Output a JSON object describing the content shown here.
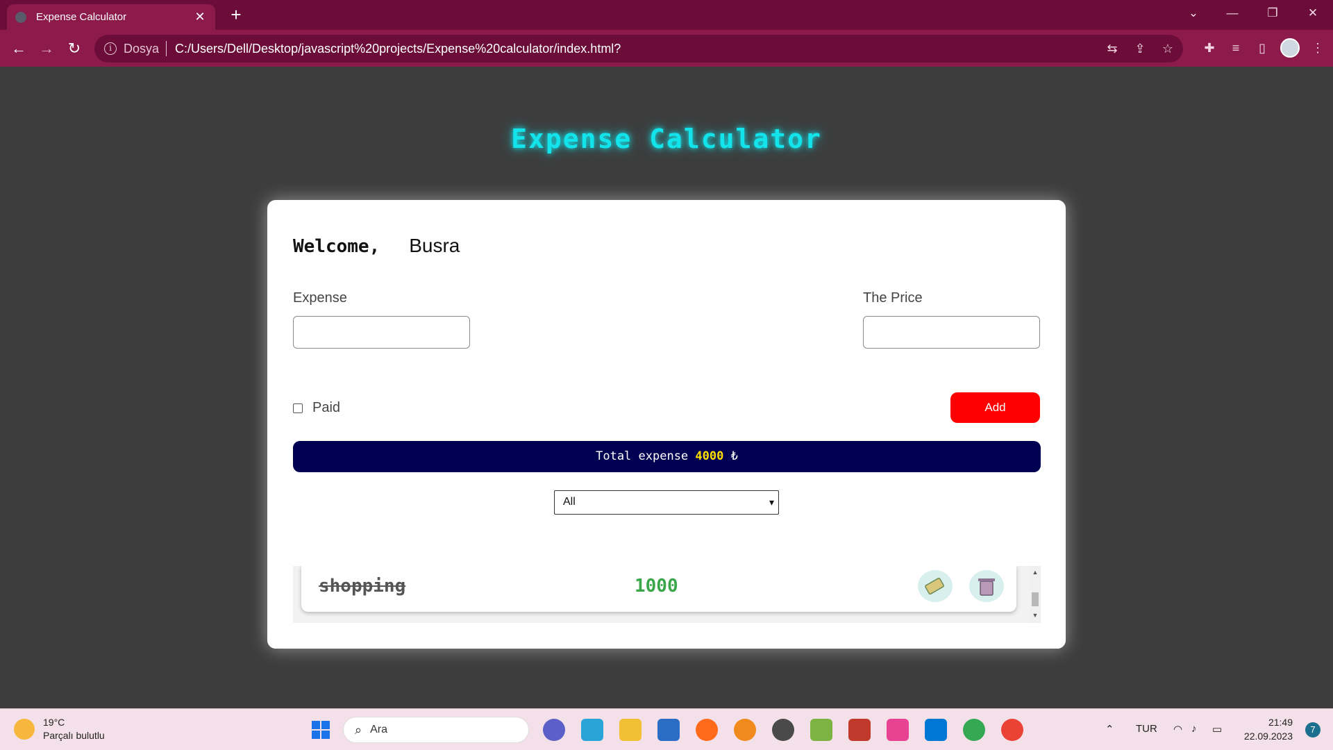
{
  "browser": {
    "tab_title": "Expense Calculator",
    "tab_close": "✕",
    "new_tab": "+",
    "scheme_label": "Dosya",
    "url": "C:/Users/Dell/Desktop/javascript%20projects/Expense%20calculator/index.html?",
    "window_controls": [
      "⌄",
      "—",
      "❐",
      "✕"
    ]
  },
  "app": {
    "title": "Expense Calculator",
    "welcome_label": "Welcome,",
    "user_name": "Busra",
    "expense_label": "Expense",
    "price_label": "The Price",
    "paid_label": "Paid",
    "add_label": "Add",
    "total_prefix": "Total expense",
    "total_amount": "4000",
    "currency": "₺",
    "filter_selected": "All",
    "items": [
      {
        "name": "shopping",
        "price": "1000",
        "paid": true
      }
    ]
  },
  "taskbar": {
    "temperature": "19°C",
    "weather": "Parçalı bulutlu",
    "search_placeholder": "Ara",
    "language": "TUR",
    "time": "21:49",
    "date": "22.09.2023",
    "notifications": "7"
  },
  "colors": {
    "title_glow": "#13e4ec",
    "add_button": "#ff0000",
    "total_bar": "#000050",
    "total_amount": "#ffe000",
    "price_text": "#3aa84a"
  }
}
